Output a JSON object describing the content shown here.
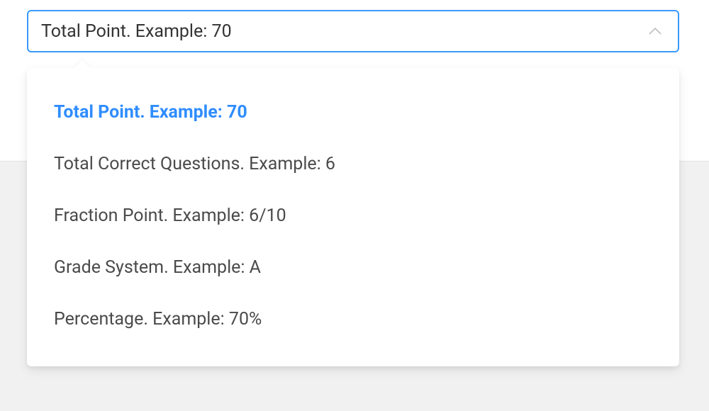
{
  "select": {
    "value": "Total Point. Example: 70",
    "options": [
      "Total Point. Example: 70",
      "Total Correct Questions. Example: 6",
      "Fraction Point. Example: 6/10",
      "Grade System. Example: A",
      "Percentage. Example: 70%"
    ],
    "selectedIndex": 0
  }
}
